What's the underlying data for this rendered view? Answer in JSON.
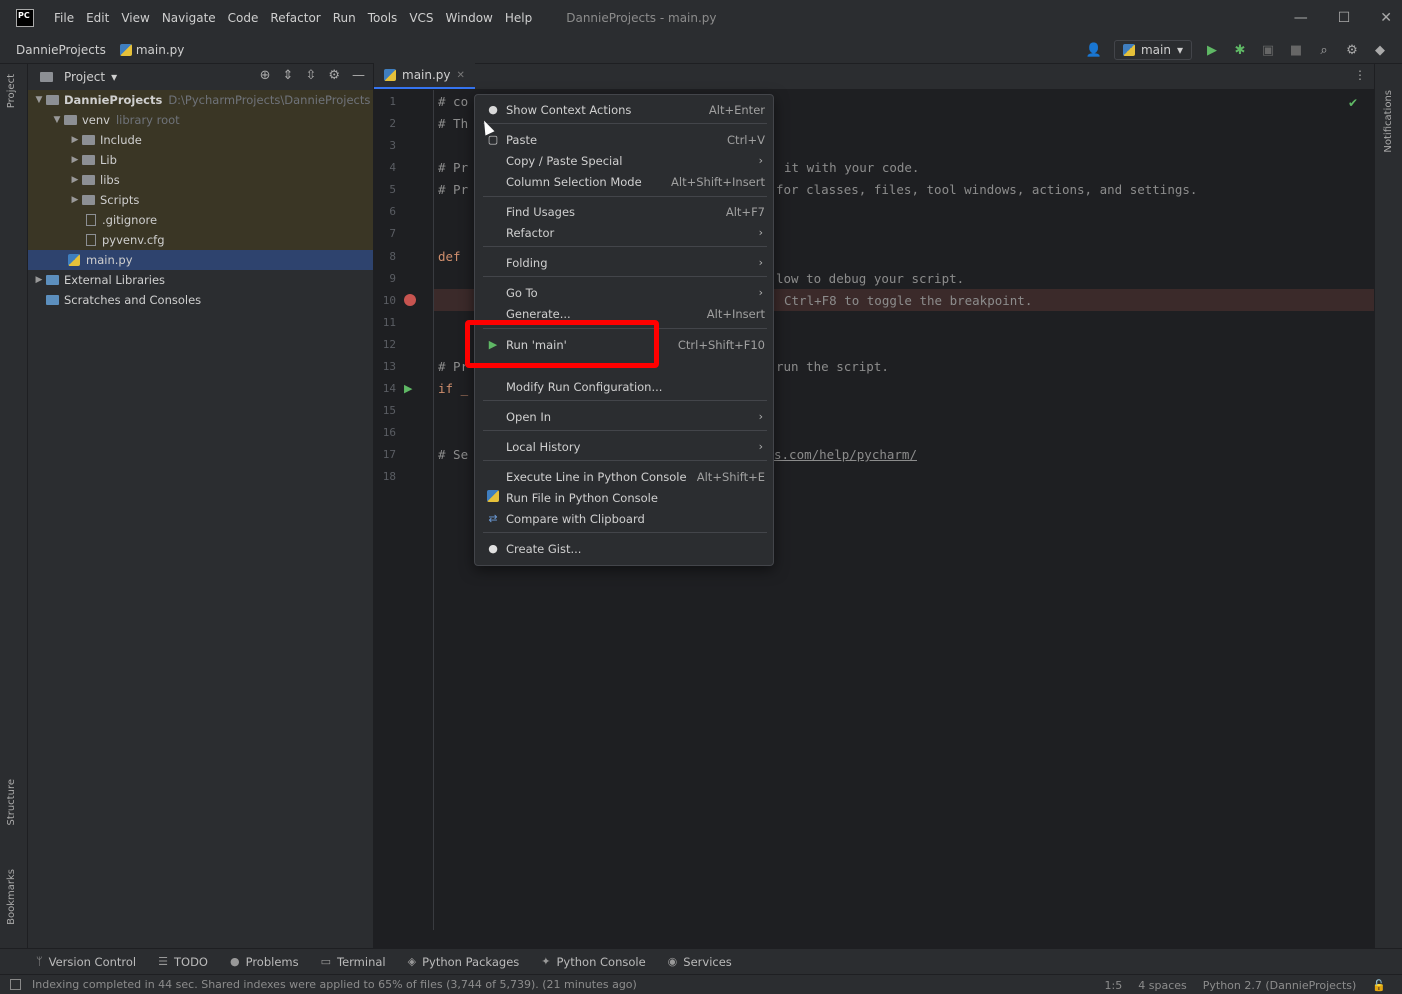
{
  "window": {
    "title": "DannieProjects - main.py",
    "menu": [
      "File",
      "Edit",
      "View",
      "Navigate",
      "Code",
      "Refactor",
      "Run",
      "Tools",
      "VCS",
      "Window",
      "Help"
    ],
    "logo_text": "PC"
  },
  "nav": {
    "project": "DannieProjects",
    "file": "main.py",
    "run_config": "main"
  },
  "project_panel": {
    "title": "Project",
    "tree": [
      {
        "label": "DannieProjects",
        "path": "D:\\PycharmProjects\\DannieProjects"
      },
      {
        "label": "venv",
        "path": "library root"
      },
      {
        "label": "Include"
      },
      {
        "label": "Lib"
      },
      {
        "label": "libs"
      },
      {
        "label": "Scripts"
      },
      {
        "label": ".gitignore"
      },
      {
        "label": "pyvenv.cfg"
      },
      {
        "label": "main.py"
      },
      {
        "label": "External Libraries"
      },
      {
        "label": "Scratches and Consoles"
      }
    ]
  },
  "editor": {
    "tab": "main.py",
    "line_numbers": [
      "1",
      "2",
      "3",
      "4",
      "5",
      "6",
      "7",
      "8",
      "9",
      "10",
      "11",
      "12",
      "13",
      "14",
      "15",
      "16",
      "17",
      "18"
    ],
    "code": {
      "l1": "# co",
      "l2": "# Th",
      "l4": "# Pr",
      "l4_tail": "it with your code.",
      "l5": "# Pr",
      "l5_tail": "for classes, files, tool windows, actions, and settings.",
      "l8": "def",
      "l9_tail": "low to debug your script.",
      "l10_tail": "Ctrl+F8 to toggle the breakpoint.",
      "l13": "# Pr",
      "l13_tail": "run the script.",
      "l14": "if _",
      "l17": "# Se",
      "l17_tail": "s.com/help/pycharm/"
    }
  },
  "context_menu": {
    "items": [
      {
        "label": "Show Context Actions",
        "shortcut": "Alt+Enter"
      },
      {
        "label": "Paste",
        "shortcut": "Ctrl+V"
      },
      {
        "label": "Copy / Paste Special",
        "shortcut": ""
      },
      {
        "label": "Column Selection Mode",
        "shortcut": "Alt+Shift+Insert"
      },
      {
        "label": "Find Usages",
        "shortcut": "Alt+F7"
      },
      {
        "label": "Refactor",
        "shortcut": ""
      },
      {
        "label": "Folding",
        "shortcut": ""
      },
      {
        "label": "Go To",
        "shortcut": ""
      },
      {
        "label": "Generate...",
        "shortcut": "Alt+Insert"
      },
      {
        "label": "Run 'main'",
        "shortcut": "Ctrl+Shift+F10"
      },
      {
        "label": "Modify Run Configuration...",
        "shortcut": ""
      },
      {
        "label": "Open In",
        "shortcut": ""
      },
      {
        "label": "Local History",
        "shortcut": ""
      },
      {
        "label": "Execute Line in Python Console",
        "shortcut": "Alt+Shift+E"
      },
      {
        "label": "Run File in Python Console",
        "shortcut": ""
      },
      {
        "label": "Compare with Clipboard",
        "shortcut": ""
      },
      {
        "label": "Create Gist...",
        "shortcut": ""
      }
    ]
  },
  "side_labels": {
    "project": "Project",
    "structure": "Structure",
    "bookmarks": "Bookmarks",
    "notifications": "Notifications"
  },
  "bottom_tools": [
    "Version Control",
    "TODO",
    "Problems",
    "Terminal",
    "Python Packages",
    "Python Console",
    "Services"
  ],
  "status": {
    "message": "Indexing completed in 44 sec. Shared indexes were applied to 65% of files (3,744 of 5,739). (21 minutes ago)",
    "position": "1:5",
    "indent": "4 spaces",
    "interpreter": "Python 2.7 (DannieProjects)"
  },
  "colors": {
    "background": "#1e1f22",
    "panel": "#2b2d30",
    "highlight_box": "#ff0000",
    "run_green": "#5fb865",
    "breakpoint": "#c75450",
    "selection": "#2e436e"
  }
}
